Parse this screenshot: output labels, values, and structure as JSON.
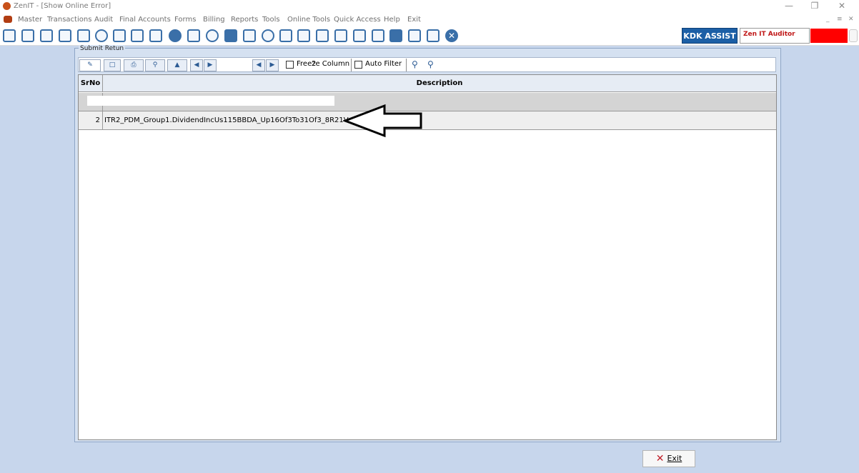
{
  "window": {
    "title": "ZenIT - [Show Online Error]"
  },
  "menubar": {
    "items": [
      "Master",
      "Transactions",
      "Audit",
      "Final Accounts",
      "Forms",
      "Billing",
      "Reports",
      "Tools",
      "Online Tools",
      "Quick Access",
      "Help",
      "Exit"
    ]
  },
  "toolbar": {
    "kdk_label": "KDK ASSIST",
    "auditor_label": "Zen IT Auditor",
    "badge_color": "#ff0000",
    "icons": [
      "rupee-icon",
      "home-icon",
      "building-icon",
      "bar-chart-icon",
      "calendar-icon",
      "users-icon",
      "tag-icon",
      "filter-add-icon",
      "save-icon",
      "eye-icon",
      "document-icon",
      "pie-chart-icon",
      "person-icon",
      "book-icon",
      "info-icon",
      "calculator-icon",
      "report-icon",
      "date-icon",
      "shield-icon",
      "refresh-icon",
      "bs-icon",
      "printer-icon",
      "form-icon",
      "export-icon",
      "close-icon"
    ]
  },
  "panel": {
    "caption": "Submit Retun"
  },
  "grid_toolbar": {
    "page_number": "2",
    "freeze_label": "Freeze Column",
    "autofilter_label": "Auto Filter"
  },
  "grid": {
    "headers": {
      "srno": "SrNo",
      "description": "Description"
    },
    "rows": [
      {
        "srno": "",
        "description": ""
      },
      {
        "srno": "2",
        "description": "ITR2_PDM_Group1.DividendIncUs115BBDA_Up16Of3To31Of3_8R21V"
      }
    ]
  },
  "footer": {
    "exit_label": "Exit"
  }
}
